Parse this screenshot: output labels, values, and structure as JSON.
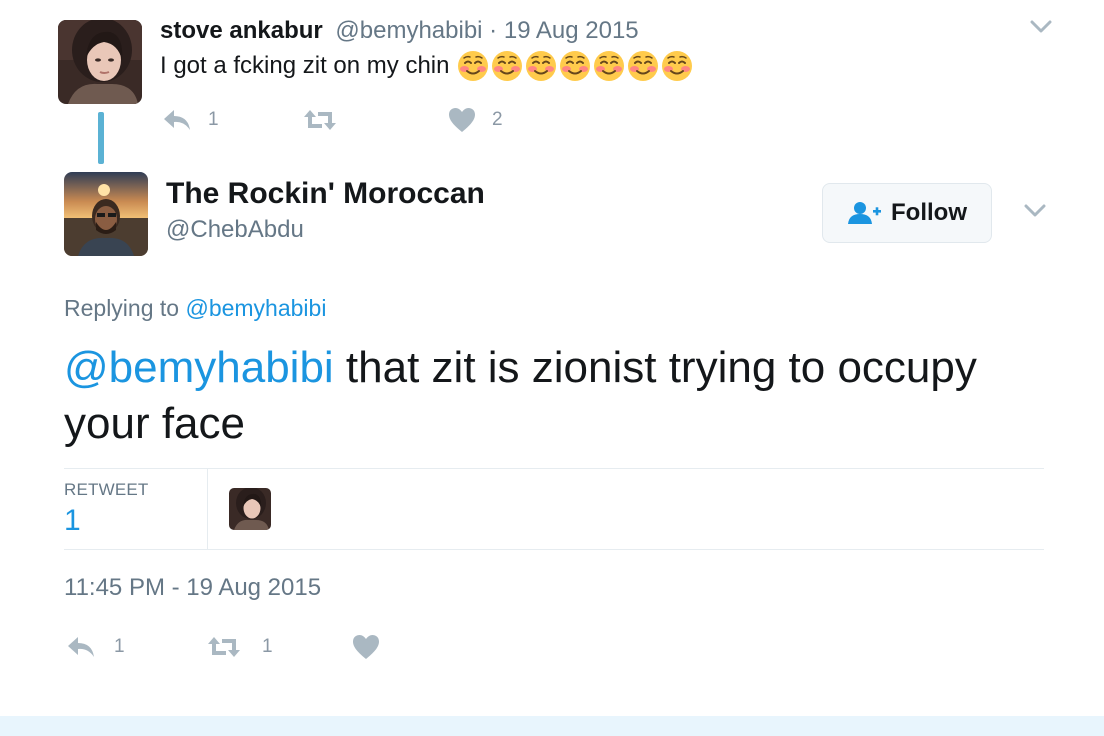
{
  "parent_tweet": {
    "name": "stove ankabur",
    "handle": "@bemyhabibi",
    "separator": " · ",
    "date": "19 Aug 2015",
    "text": "I got a fcking zit on my chin",
    "emoji": "smiling-face-with-blush",
    "emoji_count": 7,
    "reply_count": "1",
    "like_count": "2"
  },
  "main_tweet": {
    "name": "The Rockin' Moroccan",
    "handle": "@ChebAbdu",
    "follow_label": "Follow",
    "replying_prefix": "Replying to ",
    "replying_handle": "@bemyhabibi",
    "mention": "@bemyhabibi",
    "text": " that zit is zionist trying to occupy your face",
    "retweet_label": "RETWEET",
    "retweet_count": "1",
    "timestamp": "11:45 PM - 19 Aug 2015",
    "reply_count": "1",
    "retweet_action_count": "1"
  },
  "icons": {
    "reply": "reply-icon",
    "retweet": "retweet-icon",
    "like": "heart-icon",
    "more": "chevron-down-icon",
    "follow": "add-user-icon"
  },
  "colors": {
    "link": "#1b95e0",
    "muted": "#657786",
    "action_icon": "#aab8c2",
    "thread_line": "#5bb2d4",
    "footer": "#e8f5fd"
  }
}
